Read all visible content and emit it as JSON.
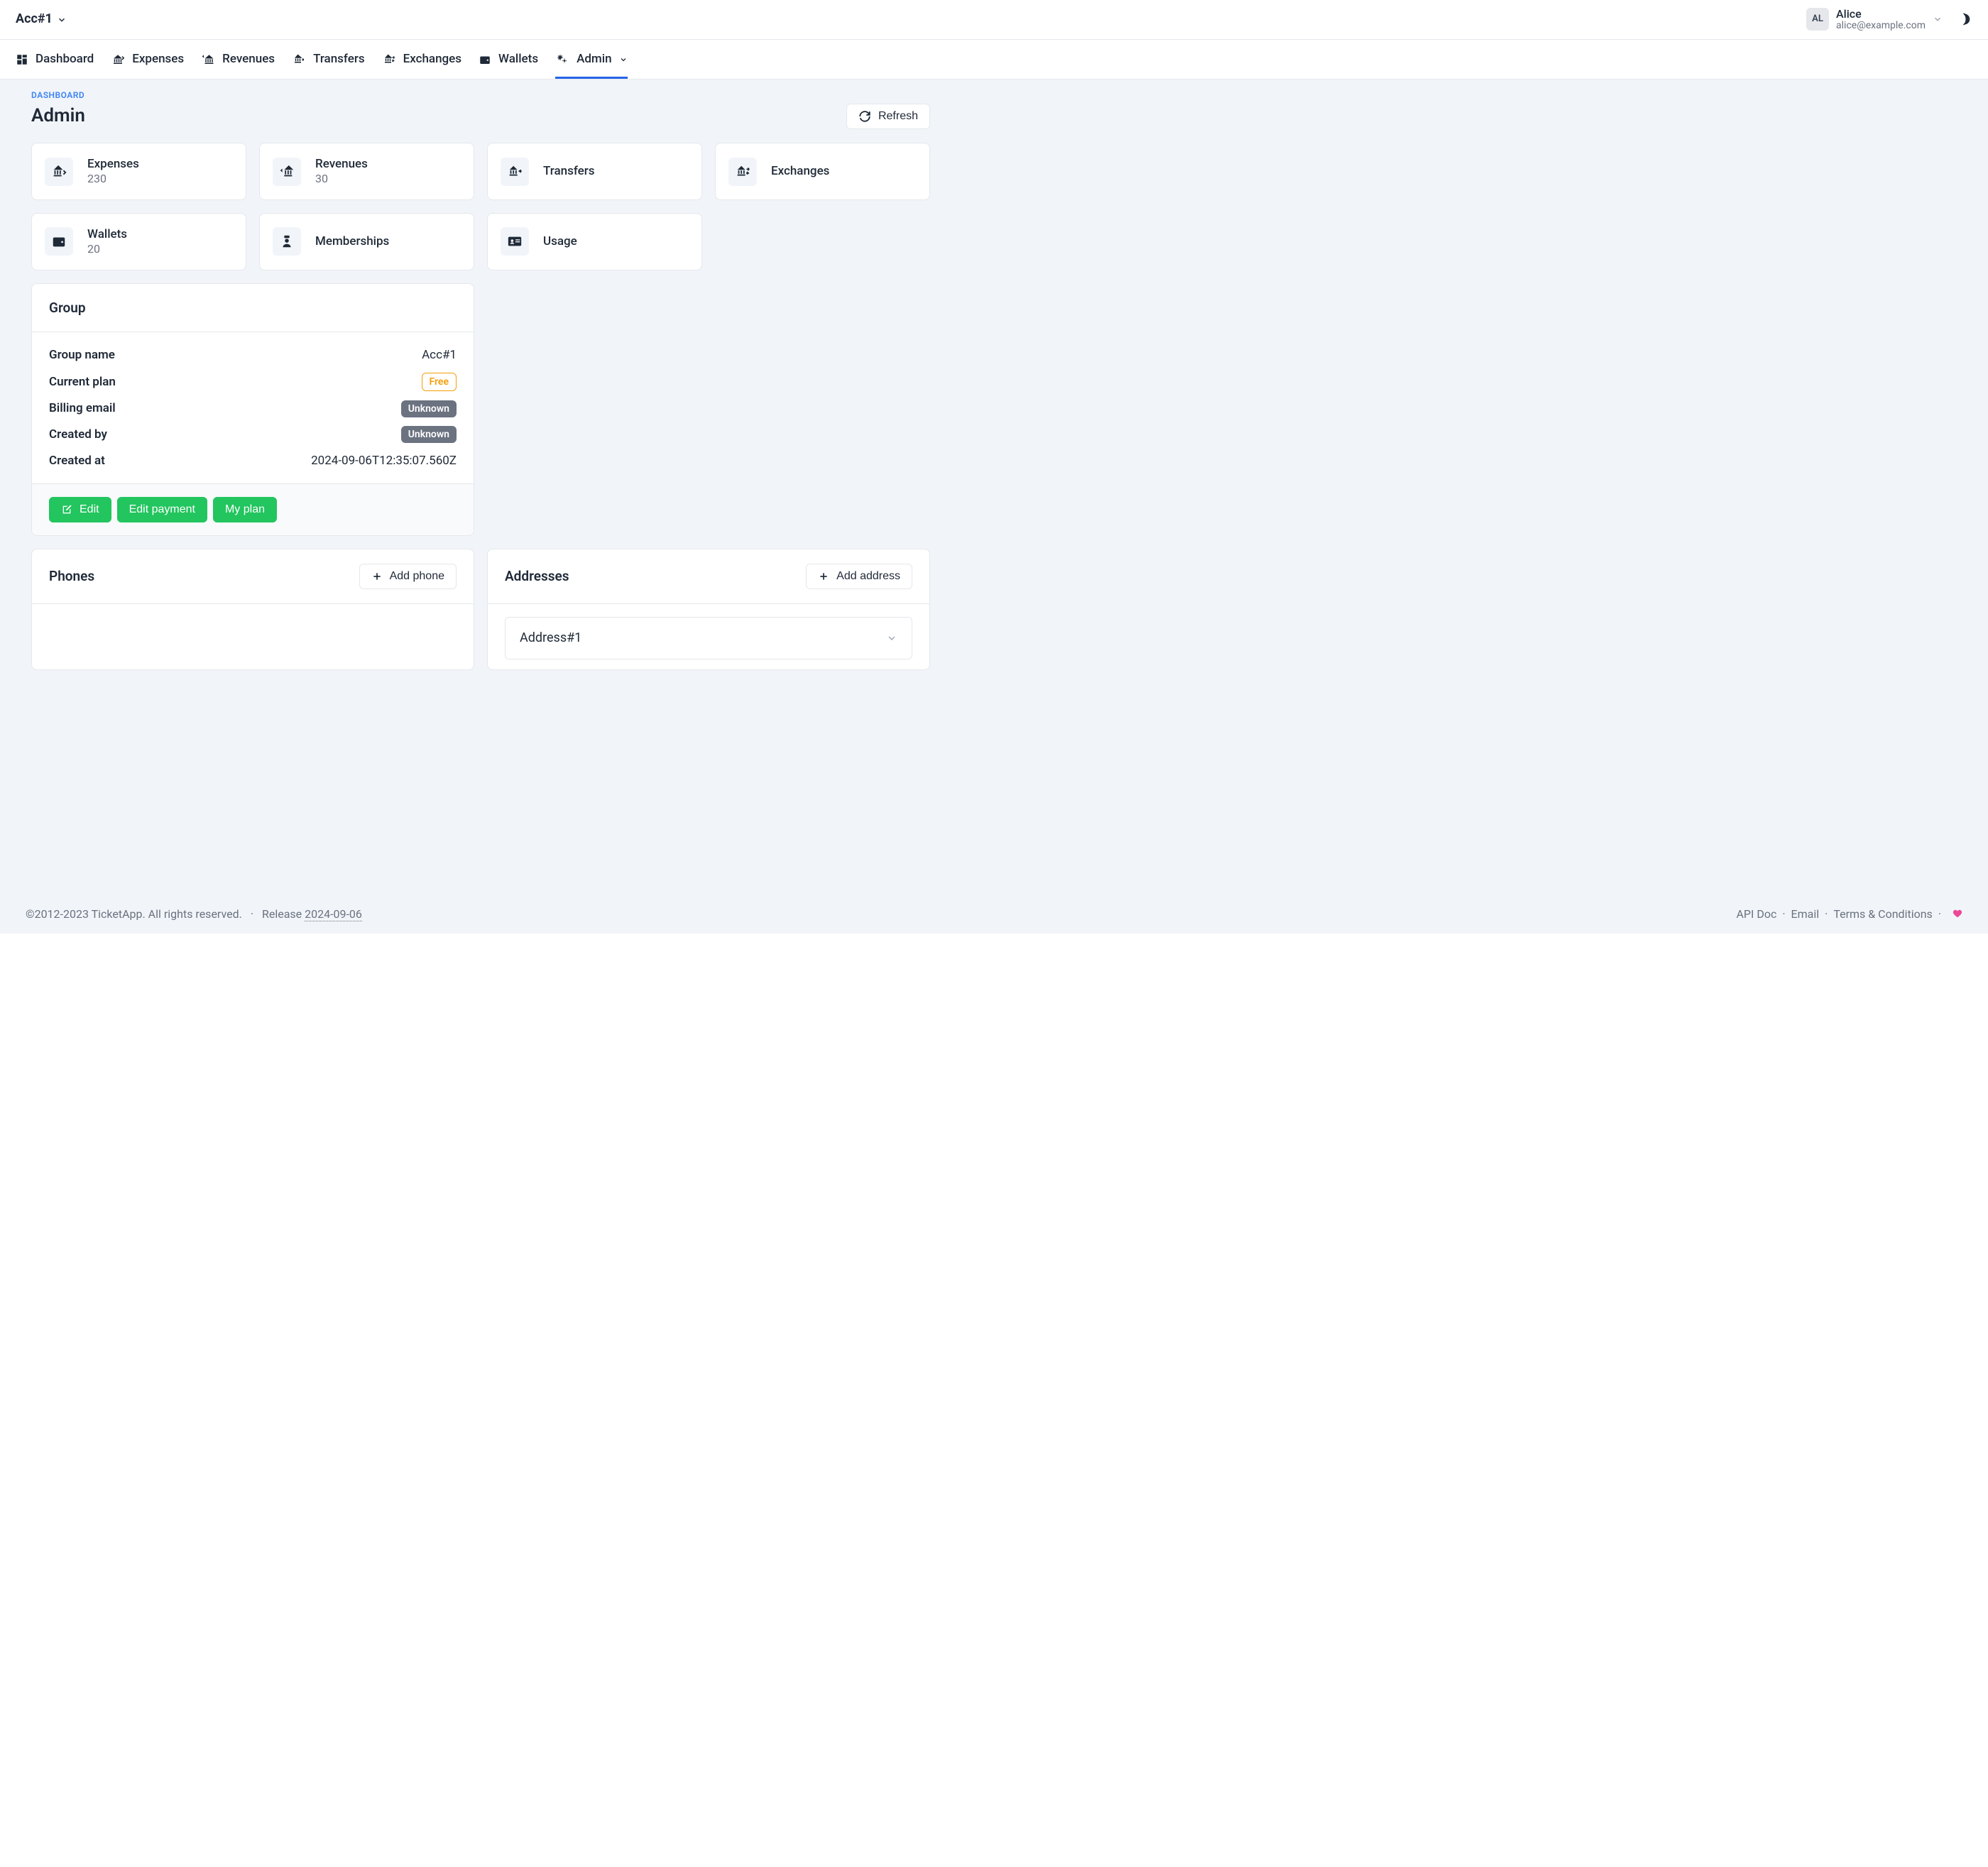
{
  "topbar": {
    "account": "Acc#1",
    "user": {
      "initials": "AL",
      "name": "Alice",
      "email": "alice@example.com"
    }
  },
  "nav": {
    "dashboard": "Dashboard",
    "expenses": "Expenses",
    "revenues": "Revenues",
    "transfers": "Transfers",
    "exchanges": "Exchanges",
    "wallets": "Wallets",
    "admin": "Admin"
  },
  "page": {
    "breadcrumb": "DASHBOARD",
    "title": "Admin",
    "refresh": "Refresh"
  },
  "stats": {
    "expenses": {
      "label": "Expenses",
      "value": "230"
    },
    "revenues": {
      "label": "Revenues",
      "value": "30"
    },
    "transfers": {
      "label": "Transfers"
    },
    "exchanges": {
      "label": "Exchanges"
    },
    "wallets": {
      "label": "Wallets",
      "value": "20"
    },
    "memberships": {
      "label": "Memberships"
    },
    "usage": {
      "label": "Usage"
    }
  },
  "group": {
    "title": "Group",
    "rows": {
      "name_label": "Group name",
      "name_value": "Acc#1",
      "plan_label": "Current plan",
      "plan_value": "Free",
      "billing_label": "Billing email",
      "billing_value": "Unknown",
      "creator_label": "Created by",
      "creator_value": "Unknown",
      "created_label": "Created at",
      "created_value": "2024-09-06T12:35:07.560Z"
    },
    "buttons": {
      "edit": "Edit",
      "edit_payment": "Edit payment",
      "my_plan": "My plan"
    }
  },
  "phones": {
    "title": "Phones",
    "add": "Add phone"
  },
  "addresses": {
    "title": "Addresses",
    "add": "Add address",
    "items": [
      {
        "label": "Address#1"
      }
    ]
  },
  "footer": {
    "copyright": "©2012-2023 TicketApp. All rights reserved.",
    "release_prefix": "Release ",
    "release_date": "2024-09-06",
    "api": "API Doc",
    "email": "Email",
    "terms": "Terms & Conditions"
  }
}
